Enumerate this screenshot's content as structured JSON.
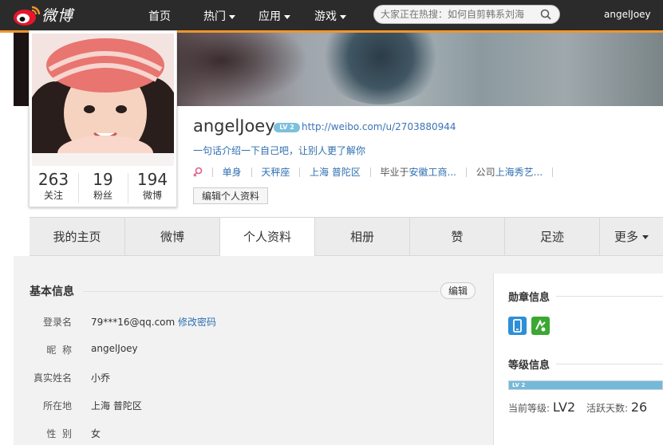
{
  "topbar": {
    "logo_text": "微博",
    "nav": [
      {
        "label": "首页",
        "has_arrow": false
      },
      {
        "label": "热门",
        "has_arrow": true
      },
      {
        "label": "应用",
        "has_arrow": true
      },
      {
        "label": "游戏",
        "has_arrow": true
      }
    ],
    "search_placeholder": "大家正在热搜：如何自剪韩系刘海",
    "username": "angelJoey"
  },
  "profile": {
    "name": "angelJoey",
    "level_badge": "LV 2",
    "url": "http://weibo.com/u/2703880944",
    "bio": "一句话介绍一下自己吧，让别人更了解你",
    "tags": [
      {
        "text": "单身",
        "link": true
      },
      {
        "text": "天秤座",
        "link": true
      },
      {
        "text": "上海 普陀区",
        "link": true
      },
      {
        "prefix": "毕业于",
        "text": "安徽工商...",
        "link": true
      },
      {
        "prefix": "公司",
        "text": "上海秀艺...",
        "link": true
      }
    ],
    "edit_button": "编辑个人资料"
  },
  "stats": [
    {
      "num": "263",
      "label": "关注"
    },
    {
      "num": "19",
      "label": "粉丝"
    },
    {
      "num": "194",
      "label": "微博"
    }
  ],
  "tabs": [
    {
      "label": "我的主页",
      "active": false
    },
    {
      "label": "微博",
      "active": false
    },
    {
      "label": "个人资料",
      "active": true
    },
    {
      "label": "相册",
      "active": false
    },
    {
      "label": "赞",
      "active": false
    },
    {
      "label": "足迹",
      "active": false
    },
    {
      "label": "更多",
      "active": false,
      "has_arrow": true
    }
  ],
  "basic_info": {
    "title": "基本信息",
    "edit_button": "编辑",
    "fields": [
      {
        "label": "登录名",
        "value": "79***16@qq.com",
        "link": "修改密码"
      },
      {
        "label": "昵  称",
        "value": "angelJoey"
      },
      {
        "label": "真实姓名",
        "value": "小乔"
      },
      {
        "label": "所在地",
        "value": "上海 普陀区"
      },
      {
        "label": "性  别",
        "value": "女"
      }
    ]
  },
  "side": {
    "medal_title": "勋章信息",
    "medals": [
      {
        "icon": "phone-medal-icon",
        "color": "#2e8fd6"
      },
      {
        "icon": "app-medal-icon",
        "color": "#3aa832"
      }
    ],
    "level_title": "等级信息",
    "level_bar_label": "LV 2",
    "level_progress": 1.0,
    "current_level_label": "当前等级:",
    "current_level": "LV2",
    "active_days_label": "活跃天数:",
    "active_days": "26"
  },
  "colors": {
    "topbar_bg": "#2b2b2b",
    "accent_orange": "#f2942e",
    "link_blue": "#2f6fb0"
  }
}
